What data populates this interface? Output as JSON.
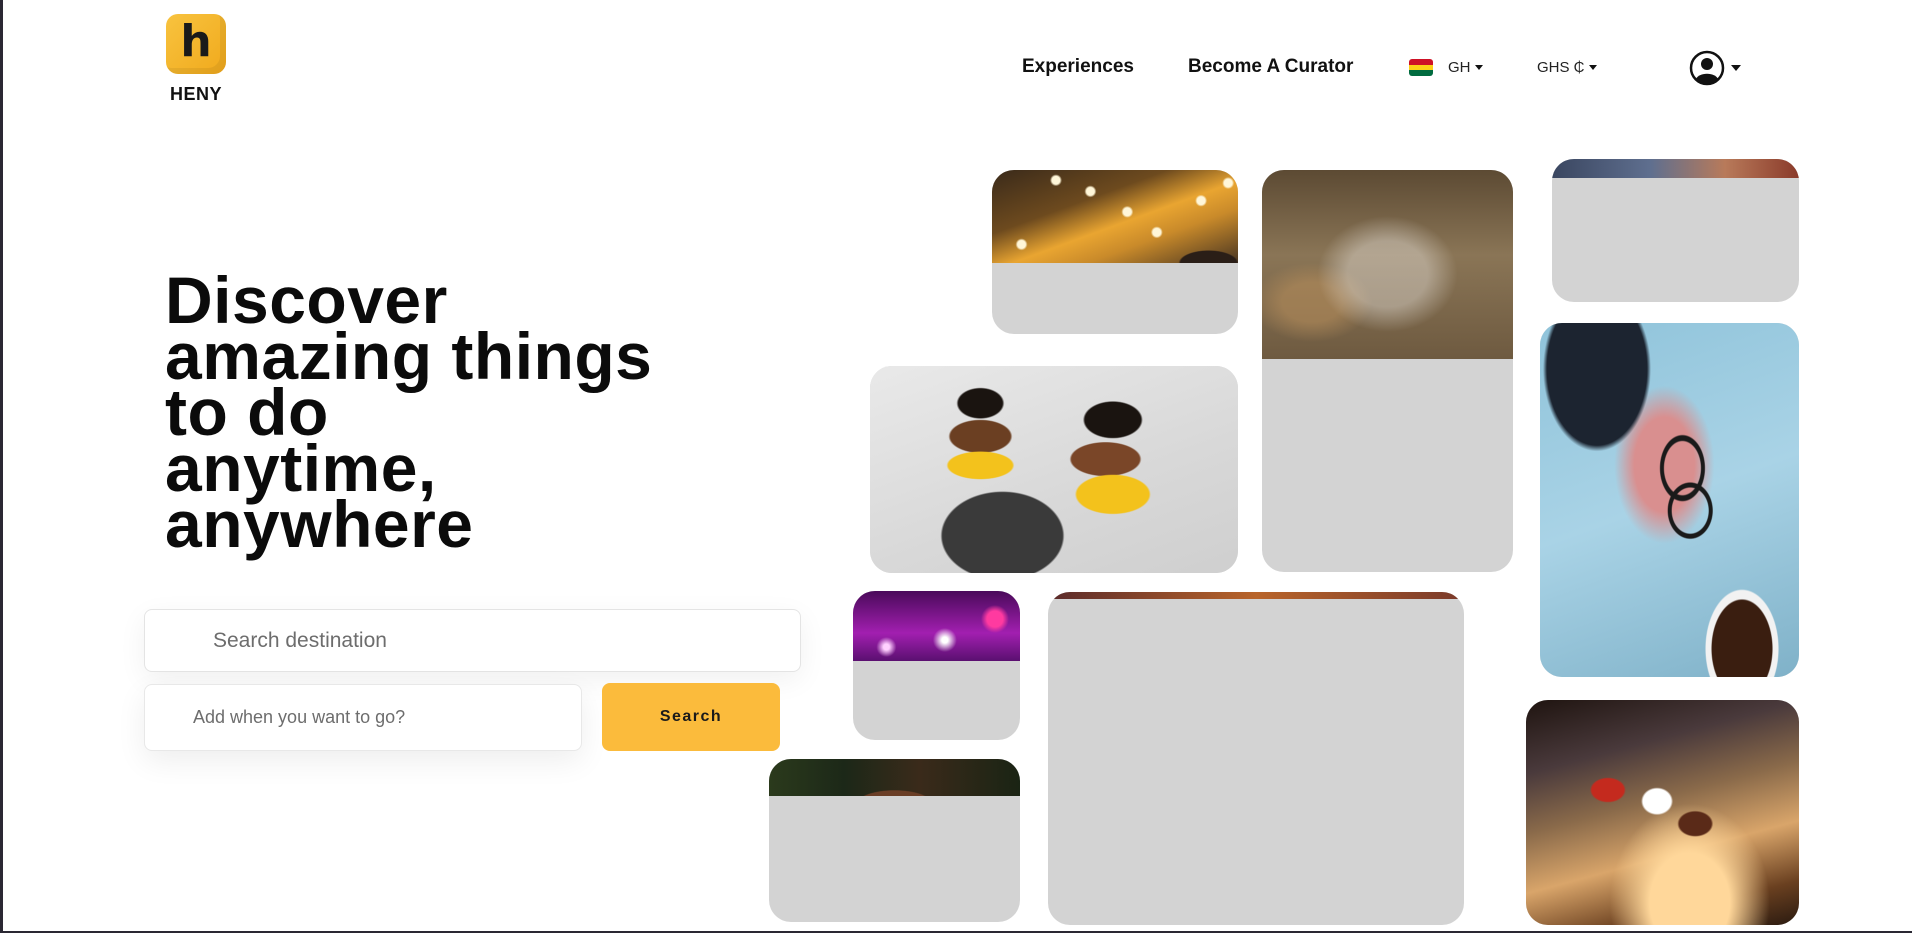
{
  "brand": {
    "logo_letter": "h",
    "name": "HENY",
    "accent_color": "#fbbb3c"
  },
  "nav": {
    "experiences": "Experiences",
    "become_curator": "Become A Curator",
    "country": "GH",
    "currency": "GHS ₵"
  },
  "hero": {
    "title_lines": [
      "Discover",
      "amazing things",
      "to do",
      "anytime,",
      "anywhere"
    ]
  },
  "search": {
    "destination_placeholder": "Search destination",
    "when_placeholder": "Add when you want to go?",
    "button_label": "Search"
  },
  "icons": {
    "country_flag": "ghana-flag-icon",
    "account": "user-circle-icon",
    "dropdown": "caret-down-icon"
  },
  "gallery": {
    "placeholder_color": "#d3d3d3",
    "cards": [
      {
        "id": "string-lights",
        "loaded_fraction": 0.57
      },
      {
        "id": "glass-bottle",
        "loaded_fraction": 0.47
      },
      {
        "id": "sky-photo",
        "loaded_fraction": 0.13
      },
      {
        "id": "women-in-yellow",
        "loaded_fraction": 1.0
      },
      {
        "id": "map-camera-glasses",
        "loaded_fraction": 1.0
      },
      {
        "id": "fireworks",
        "loaded_fraction": 0.47
      },
      {
        "id": "event-crowd",
        "loaded_fraction": 0.02
      },
      {
        "id": "portrait",
        "loaded_fraction": 0.23
      },
      {
        "id": "paint-palette",
        "loaded_fraction": 1.0
      }
    ]
  }
}
